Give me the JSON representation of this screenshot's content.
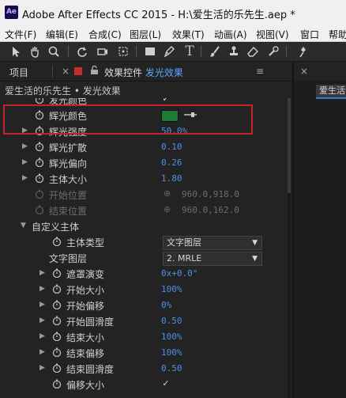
{
  "window": {
    "app_icon_text": "Ae",
    "title": "Adobe After Effects CC 2015 - H:\\爱生活的乐先生.aep *"
  },
  "menu": [
    "文件(F)",
    "编辑(E)",
    "合成(C)",
    "图层(L)",
    "效果(T)",
    "动画(A)",
    "视图(V)",
    "窗口",
    "帮助"
  ],
  "panel": {
    "projects_tab": "项目",
    "effects_tab_prefix": "效果控件",
    "effects_tab_layer": "发光效果",
    "menu_glyph": "≡",
    "breadcrumb": "爱生活的乐先生 • 发光效果",
    "right_tab": "爱生活的乐先生"
  },
  "properties": [
    {
      "name": "发光颜色"
    },
    {
      "name": "辉光颜色"
    },
    {
      "name": "辉光强度",
      "value": "50.0%"
    },
    {
      "name": "辉光扩散",
      "value": "0.10"
    },
    {
      "name": "辉光偏向",
      "value": "0.26"
    },
    {
      "name": "主体大小",
      "value": "1.80"
    },
    {
      "name": "开始位置",
      "value": "960.0,918.0"
    },
    {
      "name": "结束位置",
      "value": "960.0,162.0"
    },
    {
      "name": "自定义主体"
    },
    {
      "name": "主体类型",
      "value": "文字图层"
    },
    {
      "name": "文字图层",
      "value": "2. MRLE"
    },
    {
      "name": "遮罩演变",
      "value": "0x+0.0°"
    },
    {
      "name": "开始大小",
      "value": "100%"
    },
    {
      "name": "开始偏移",
      "value": "0%"
    },
    {
      "name": "开始圆滑度",
      "value": "0.50"
    },
    {
      "name": "结束大小",
      "value": "100%"
    },
    {
      "name": "结束偏移",
      "value": "100%"
    },
    {
      "name": "结束圆滑度",
      "value": "0.50"
    },
    {
      "name": "偏移大小"
    }
  ],
  "colors": {
    "glow_color": "#1f7a34",
    "highlight_box": "#c3242b",
    "value_blue": "#4d8fe6"
  },
  "icons": [
    "selection-tool-icon",
    "hand-tool-icon",
    "zoom-tool-icon",
    "rotate-tool-icon",
    "camera-tool-icon",
    "pan-behind-tool-icon",
    "mask-tool-icon",
    "pen-tool-icon",
    "type-tool-icon",
    "brush-tool-icon",
    "clone-stamp-tool-icon",
    "eraser-tool-icon",
    "roto-brush-tool-icon",
    "puppet-pin-tool-icon"
  ]
}
